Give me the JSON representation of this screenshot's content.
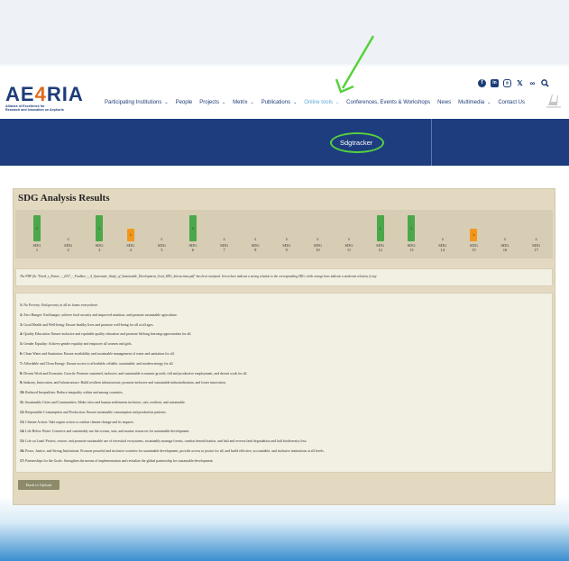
{
  "header": {
    "logo_text_left": "AE",
    "logo_text_four": "4",
    "logo_text_right": "RIA",
    "logo_subtitle_1": "Alliance of Excellence for",
    "logo_subtitle_2": "Research and Innovation on Aephoria",
    "nav": [
      {
        "label": "Participating Institutions",
        "chevron": true,
        "active": false
      },
      {
        "label": "People",
        "chevron": false,
        "active": false
      },
      {
        "label": "Projects",
        "chevron": true,
        "active": false
      },
      {
        "label": "Metrix",
        "chevron": true,
        "active": false
      },
      {
        "label": "Publications",
        "chevron": true,
        "active": false
      },
      {
        "label": "Online tools",
        "chevron": true,
        "active": true
      },
      {
        "label": "Conferences, Events & Workshops",
        "chevron": false,
        "active": false
      },
      {
        "label": "News",
        "chevron": false,
        "active": false
      },
      {
        "label": "Multimedia",
        "chevron": true,
        "active": false
      },
      {
        "label": "Contact Us",
        "chevron": false,
        "active": false
      }
    ],
    "social_icons": [
      "facebook-icon",
      "linkedin-icon",
      "instagram-icon",
      "x-icon",
      "infinity-icon",
      "search-icon"
    ]
  },
  "banner": {
    "tool_label": "Sdgtracker"
  },
  "results": {
    "title": "SDG Analysis Results",
    "sdg_prefix": "SDG",
    "note": "The PDF file \"Earth_s_Future_-_2017_-_Fradkov_-_A_Systematic_Study_of_Sustainable_Development_Goal_SDG_Interactions.pdf\" has been analyzed. Green bars indicate a strong relation to the corresponding SDG, while orange bars indicate a moderate relation, if any.",
    "goals": [
      {
        "num": "1:",
        "text": "No Poverty: End poverty in all its forms everywhere."
      },
      {
        "num": "2:",
        "text": "Zero Hunger: End hunger, achieve food security and improved nutrition, and promote sustainable agriculture."
      },
      {
        "num": "3:",
        "text": "Good Health and Well-being: Ensure healthy lives and promote well-being for all at all ages."
      },
      {
        "num": "4:",
        "text": "Quality Education: Ensure inclusive and equitable quality education and promote lifelong learning opportunities for all."
      },
      {
        "num": "5:",
        "text": "Gender Equality: Achieve gender equality and empower all women and girls."
      },
      {
        "num": "6:",
        "text": "Clean Water and Sanitation: Ensure availability and sustainable management of water and sanitation for all."
      },
      {
        "num": "7:",
        "text": "Affordable and Clean Energy: Ensure access to affordable, reliable, sustainable, and modern energy for all."
      },
      {
        "num": "8:",
        "text": "Decent Work and Economic Growth: Promote sustained, inclusive, and sustainable economic growth, full and productive employment, and decent work for all."
      },
      {
        "num": "9:",
        "text": "Industry, Innovation, and Infrastructure: Build resilient infrastructure, promote inclusive and sustainable industrialization, and foster innovation."
      },
      {
        "num": "10:",
        "text": "Reduced Inequalities: Reduce inequality within and among countries."
      },
      {
        "num": "11:",
        "text": "Sustainable Cities and Communities: Make cities and human settlements inclusive, safe, resilient, and sustainable."
      },
      {
        "num": "12:",
        "text": "Responsible Consumption and Production: Ensure sustainable consumption and production patterns."
      },
      {
        "num": "13:",
        "text": "Climate Action: Take urgent action to combat climate change and its impacts."
      },
      {
        "num": "14:",
        "text": "Life Below Water: Conserve and sustainably use the oceans, seas, and marine resources for sustainable development."
      },
      {
        "num": "15:",
        "text": "Life on Land: Protect, restore, and promote sustainable use of terrestrial ecosystems, sustainably manage forests, combat desertification, and halt and reverse land degradation and halt biodiversity loss."
      },
      {
        "num": "16:",
        "text": "Peace, Justice, and Strong Institutions: Promote peaceful and inclusive societies for sustainable development, provide access to justice for all, and build effective, accountable, and inclusive institutions at all levels."
      },
      {
        "num": "17:",
        "text": "Partnerships for the Goals: Strengthen the means of implementation and revitalize the global partnership for sustainable development."
      }
    ],
    "back_button": "Back to Upload"
  },
  "colors": {
    "strong": "#4aa84a",
    "moderate": "#f3961a",
    "annotation": "#55d23d"
  },
  "chart_data": {
    "type": "bar",
    "categories": [
      "1",
      "2",
      "3",
      "4",
      "5",
      "6",
      "7",
      "8",
      "9",
      "10",
      "11",
      "12",
      "13",
      "14",
      "15",
      "16",
      "17"
    ],
    "values": [
      2,
      0,
      2,
      1,
      0,
      2,
      0,
      0,
      0,
      0,
      0,
      2,
      2,
      0,
      1,
      0,
      0
    ],
    "relation": [
      "strong",
      "none",
      "strong",
      "moderate",
      "none",
      "strong",
      "none",
      "none",
      "none",
      "none",
      "none",
      "strong",
      "strong",
      "none",
      "moderate",
      "none",
      "none"
    ],
    "ylim": [
      0,
      2
    ]
  }
}
